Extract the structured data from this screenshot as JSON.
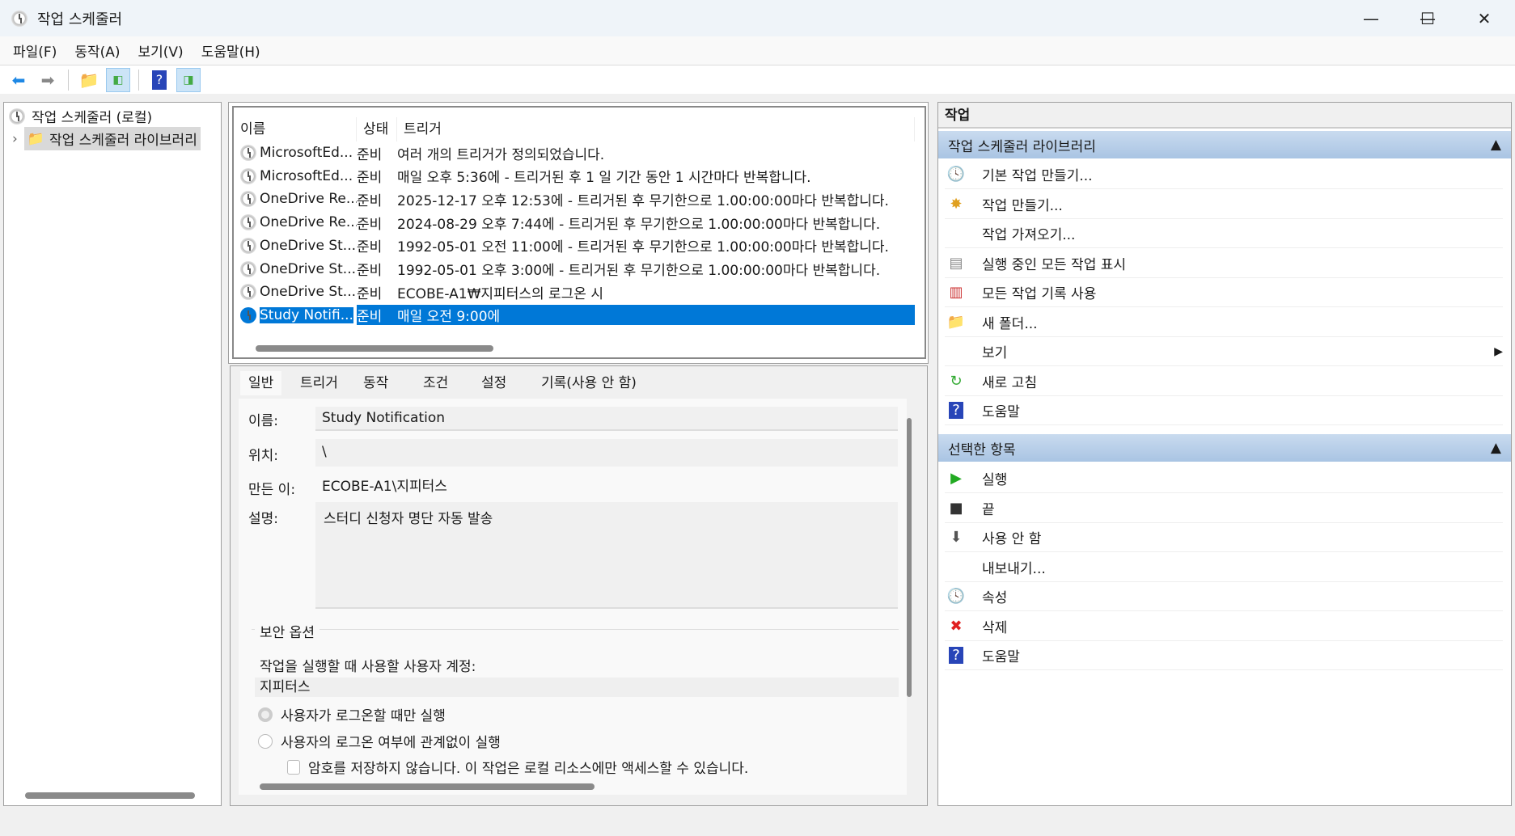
{
  "window": {
    "title": "작업 스케줄러",
    "minimize": "—",
    "maximize": "☐",
    "close": "✕"
  },
  "menu": [
    "파일(F)",
    "동작(A)",
    "보기(V)",
    "도움말(H)"
  ],
  "tree": {
    "root": "작업 스케줄러 (로컬)",
    "child": "작업 스케줄러 라이브러리",
    "expander": "›"
  },
  "list": {
    "columns": [
      "이름",
      "상태",
      "트리거"
    ],
    "rows": [
      {
        "name": "MicrosoftEd...",
        "status": "준비",
        "trigger": "여러 개의 트리거가 정의되었습니다."
      },
      {
        "name": "MicrosoftEd...",
        "status": "준비",
        "trigger": "매일 오후 5:36에 - 트리거된 후 1 일 기간 동안 1 시간마다 반복합니다."
      },
      {
        "name": "OneDrive Re...",
        "status": "준비",
        "trigger": "2025-12-17 오후 12:53에 - 트리거된 후 무기한으로 1.00:00:00마다 반복합니다."
      },
      {
        "name": "OneDrive Re...",
        "status": "준비",
        "trigger": "2024-08-29 오후 7:44에 - 트리거된 후 무기한으로 1.00:00:00마다 반복합니다."
      },
      {
        "name": "OneDrive St...",
        "status": "준비",
        "trigger": "1992-05-01 오전 11:00에 - 트리거된 후 무기한으로 1.00:00:00마다 반복합니다."
      },
      {
        "name": "OneDrive St...",
        "status": "준비",
        "trigger": "1992-05-01 오후 3:00에 - 트리거된 후 무기한으로 1.00:00:00마다 반복합니다."
      },
      {
        "name": "OneDrive St...",
        "status": "준비",
        "trigger": "ECOBE-A1₩지피터스의 로그온 시"
      },
      {
        "name": "Study Notifi...",
        "status": "준비",
        "trigger": "매일 오전 9:00에"
      }
    ]
  },
  "details": {
    "tabs": [
      "일반",
      "트리거",
      "동작",
      "조건",
      "설정",
      "기록(사용 안 함)"
    ],
    "name_label": "이름:",
    "name": "Study Notification",
    "location_label": "위치:",
    "location": "\\",
    "author_label": "만든 이:",
    "author": "ECOBE-A1\\지피터스",
    "desc_label": "설명:",
    "desc": "스터디 신청자 명단 자동 발송",
    "security_title": "보안 옵션",
    "account_label": "작업을 실행할 때 사용할 사용자 계정:",
    "account": "지피터스",
    "radio1": "사용자가 로그온할 때만 실행",
    "radio2": "사용자의 로그온 여부에 관계없이 실행",
    "checkbox": "암호를 저장하지 않습니다. 이 작업은 로컬 리소스에만 액세스할 수 있습니다."
  },
  "actions": {
    "title": "작업",
    "section1": "작업 스케줄러 라이브러리",
    "items1": [
      "기본 작업 만들기...",
      "작업 만들기...",
      "작업 가져오기...",
      "실행 중인 모든 작업 표시",
      "모든 작업 기록 사용",
      "새 폴더...",
      "보기",
      "새로 고침",
      "도움말"
    ],
    "section2": "선택한 항목",
    "items2": [
      "실행",
      "끝",
      "사용 안 함",
      "내보내기...",
      "속성",
      "삭제",
      "도움말"
    ]
  }
}
